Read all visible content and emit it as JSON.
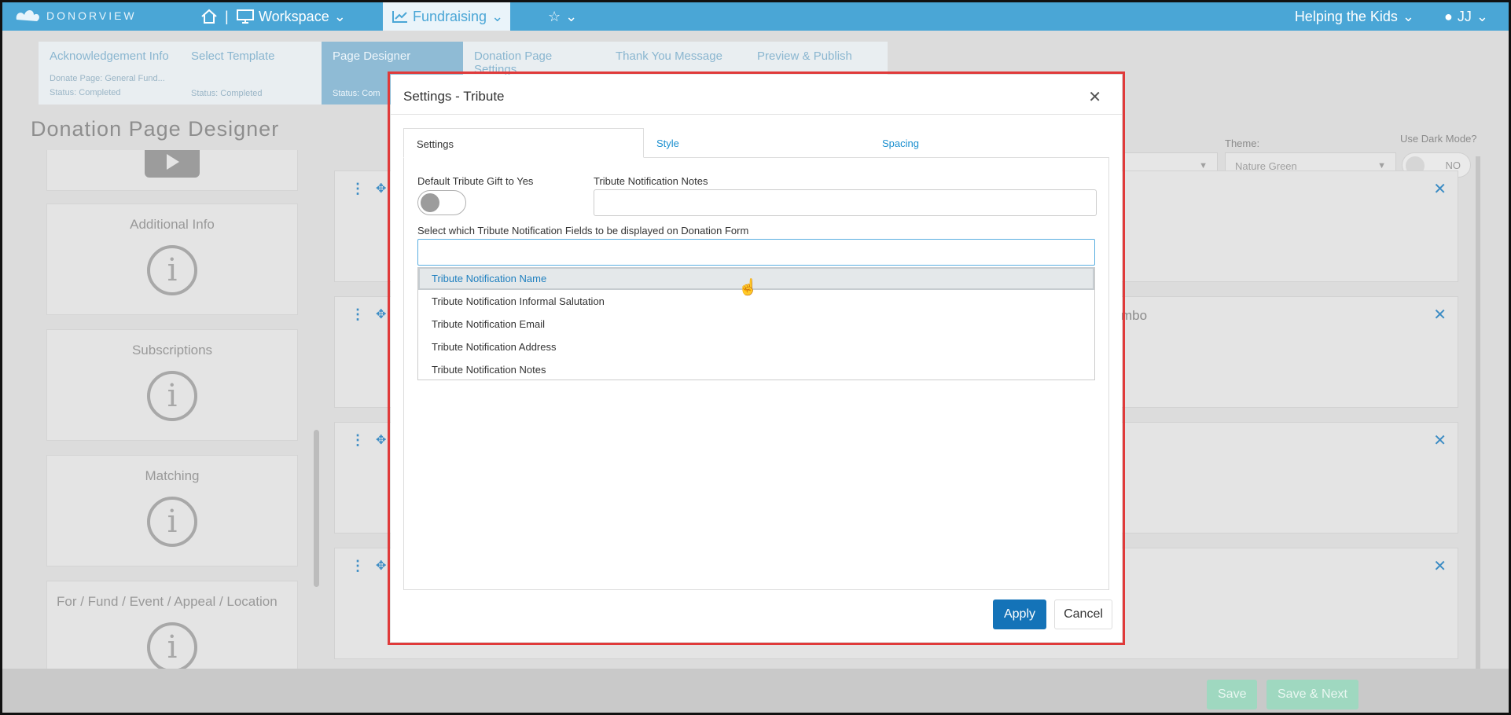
{
  "topbar": {
    "brand": "DONORVIEW",
    "separator": "|",
    "workspace": "Workspace",
    "fundraising": "Fundraising",
    "organization": "Helping the Kids",
    "user_initials": "JJ"
  },
  "steps": [
    {
      "name": "Acknowledgement Info",
      "sub": "Donate Page: General Fund...",
      "status": "Status: Completed"
    },
    {
      "name": "Select Template",
      "sub": "",
      "status": "Status: Completed"
    },
    {
      "name": "Page Designer",
      "sub": "",
      "status": "Status: Com"
    },
    {
      "name": "Donation Page Settings",
      "sub": "",
      "status": ""
    },
    {
      "name": "Thank You Message",
      "sub": "",
      "status": ""
    },
    {
      "name": "Preview & Publish",
      "sub": "",
      "status": ""
    }
  ],
  "page_title": "Donation Page Designer",
  "sidebar": {
    "cards": [
      {
        "title": "Additional Info",
        "icon": "info-icon"
      },
      {
        "title": "Subscriptions",
        "icon": "info-icon"
      },
      {
        "title": "Matching",
        "icon": "info-icon"
      },
      {
        "title": "For / Fund / Event / Appeal / Location",
        "icon": "info-icon"
      }
    ]
  },
  "theme": {
    "label": "Theme:",
    "value": "Nature Green"
  },
  "dark_mode": {
    "label": "Use Dark Mode?",
    "value": "NO"
  },
  "row_cards": [
    {
      "text": ""
    },
    {
      "text": "mbo"
    },
    {
      "text": ""
    },
    {
      "text": ""
    }
  ],
  "modal": {
    "title": "Settings - Tribute",
    "tabs": [
      "Settings",
      "Style",
      "Spacing"
    ],
    "default_tribute_label": "Default Tribute Gift to Yes",
    "default_tribute_on": false,
    "notes_label": "Tribute Notification Notes",
    "notes_value": "",
    "fields_label": "Select which Tribute Notification Fields to be displayed on Donation Form",
    "fields_value": "",
    "options": [
      "Tribute Notification Name",
      "Tribute Notification Informal Salutation",
      "Tribute Notification Email",
      "Tribute Notification Address",
      "Tribute Notification Notes"
    ],
    "apply_label": "Apply",
    "cancel_label": "Cancel"
  },
  "bottom": {
    "save_label": "Save",
    "save_next_label": "Save & Next"
  },
  "colors": {
    "topbar": "#4aa6d6",
    "primary": "#1473b8",
    "highlight_border": "#e03a3a"
  }
}
